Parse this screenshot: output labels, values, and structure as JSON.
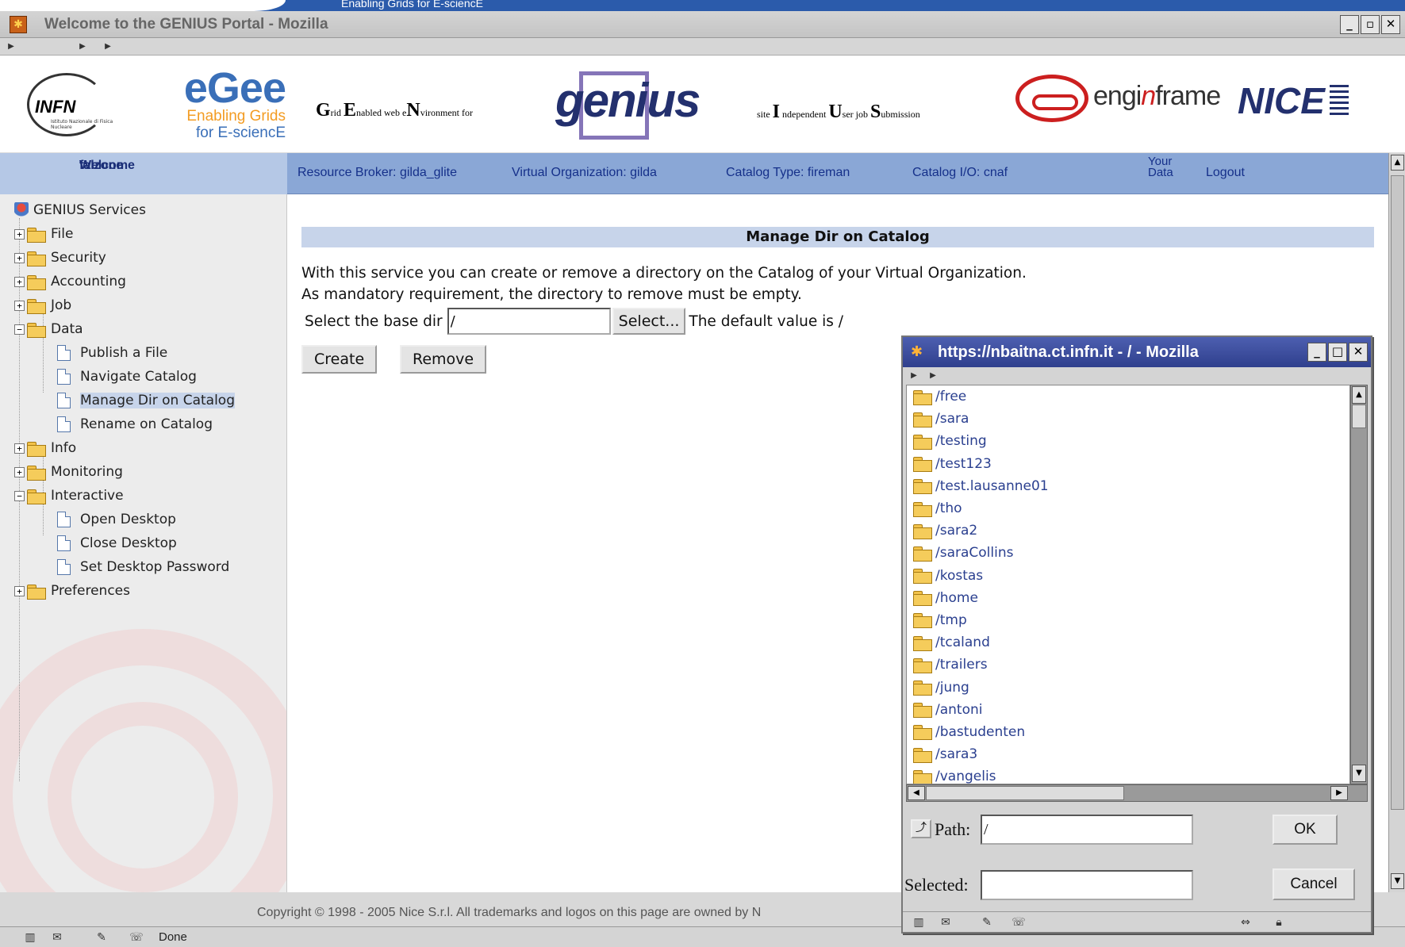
{
  "banner": {
    "text": "Enabling Grids for E-sciencE"
  },
  "window": {
    "title": "Welcome to the GENIUS Portal - Mozilla"
  },
  "header": {
    "infn_logo": {
      "text": "INFN",
      "sub": "Istituto Nazionale di Fisica Nucleare"
    },
    "egee_logo": {
      "big": "eGee",
      "line1": "Enabling Grids",
      "line2": "for E-sciencE"
    },
    "genius_tagline": {
      "g": "G",
      "rid": "rid ",
      "e": "E",
      "nabled": "nabled web e",
      "n": "N",
      "vironment": "vironment for"
    },
    "genius_logo": "genius",
    "enginframe_tagline": {
      "pre": "site ",
      "i": "I",
      "ndependent": " ndependent ",
      "u": "U",
      "ser": "ser job ",
      "s": "S",
      "ubmission": "ubmission"
    },
    "enginframe_logo": {
      "pre": "engi",
      "mid": "n",
      "post": "frame"
    },
    "nice_logo": "NICE"
  },
  "infobar": {
    "welcome_line1": "Welcome",
    "welcome_line2": "falzone",
    "resource_broker": "Resource Broker: gilda_glite",
    "virtual_org": "Virtual Organization: gilda",
    "catalog_type": "Catalog Type: fireman",
    "catalog_io": "Catalog I/O: cnaf",
    "your_data_line1": "Your",
    "your_data_line2": "Data",
    "logout": "Logout"
  },
  "sidebar": {
    "root": "GENIUS Services",
    "items": [
      {
        "label": "File",
        "expander": "+"
      },
      {
        "label": "Security",
        "expander": "+"
      },
      {
        "label": "Accounting",
        "expander": "+"
      },
      {
        "label": "Job",
        "expander": "+"
      },
      {
        "label": "Data",
        "expander": "−"
      },
      {
        "label": "Publish a File"
      },
      {
        "label": "Navigate Catalog"
      },
      {
        "label": "Manage Dir on Catalog"
      },
      {
        "label": "Rename on Catalog"
      },
      {
        "label": "Info",
        "expander": "+"
      },
      {
        "label": "Monitoring",
        "expander": "+"
      },
      {
        "label": "Interactive",
        "expander": "−"
      },
      {
        "label": "Open Desktop"
      },
      {
        "label": "Close Desktop"
      },
      {
        "label": "Set Desktop Password"
      },
      {
        "label": "Preferences",
        "expander": "+"
      }
    ]
  },
  "main": {
    "heading": "Manage Dir on Catalog",
    "description_line1": "With this service you can create or remove a directory on the Catalog of your Virtual Organization.",
    "description_line2": "As mandatory requirement, the directory to remove must be empty.",
    "base_dir_label": "Select the base dir",
    "base_dir_value": "/",
    "select_button": "Select...",
    "default_note": "The default value is /",
    "create_button": "Create",
    "remove_button": "Remove",
    "copyright": "Copyright © 1998 - 2005 Nice S.r.l. All trademarks and logos on this page are owned by N"
  },
  "statusbar": {
    "status_text": "Done"
  },
  "popup": {
    "title": "https://nbaitna.ct.infn.it - / - Mozilla",
    "directories": [
      "/free",
      "/sara",
      "/testing",
      "/test123",
      "/test.lausanne01",
      "/tho",
      "/sara2",
      "/saraCollins",
      "/kostas",
      "/home",
      "/tmp",
      "/tcaland",
      "/trailers",
      "/jung",
      "/antoni",
      "/bastudenten",
      "/sara3",
      "/vangelis"
    ],
    "path_label": "Path:",
    "path_value": "/",
    "selected_label": "Selected:",
    "selected_value": "",
    "ok_button": "OK",
    "cancel_button": "Cancel"
  }
}
